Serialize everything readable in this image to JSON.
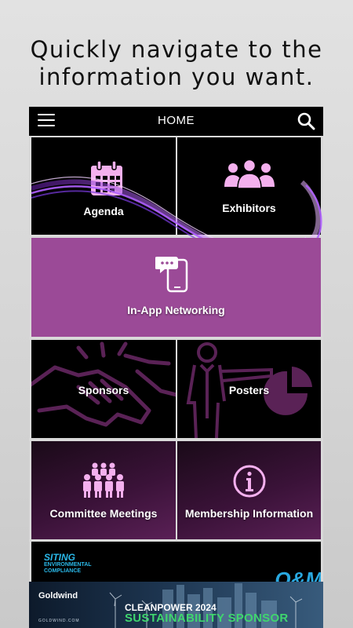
{
  "headline": {
    "line1": "Quickly navigate to the",
    "line2": "information you want."
  },
  "topbar": {
    "title": "HOME",
    "menu_icon": "hamburger-menu-icon",
    "search_icon": "search-icon"
  },
  "tiles": [
    {
      "label": "Agenda",
      "icon": "calendar-icon"
    },
    {
      "label": "Exhibitors",
      "icon": "people-group-icon"
    },
    {
      "label": "In-App Networking",
      "icon": "phone-chat-icon"
    },
    {
      "label": "Sponsors",
      "icon": "handshake-icon"
    },
    {
      "label": "Posters",
      "icon": "presenter-chart-icon"
    },
    {
      "label": "Committee Meetings",
      "icon": "committee-group-icon"
    },
    {
      "label": "Membership Information",
      "icon": "info-circle-icon"
    }
  ],
  "banner": {
    "title": "SITING",
    "subtitle_line1": "ENVIRONMENTAL",
    "subtitle_line2": "COMPLIANCE",
    "right_text": "O&M"
  },
  "ad": {
    "brand": "Goldwind",
    "brand_url": "GOLDWIND.COM",
    "line1": "CLEANPOWER 2024",
    "line2": "SUSTAINABILITY SPONSOR"
  },
  "colors": {
    "accent_purple": "#9b4a97",
    "icon_pink": "#f4b0ee",
    "ad_green": "#3fd66e"
  }
}
